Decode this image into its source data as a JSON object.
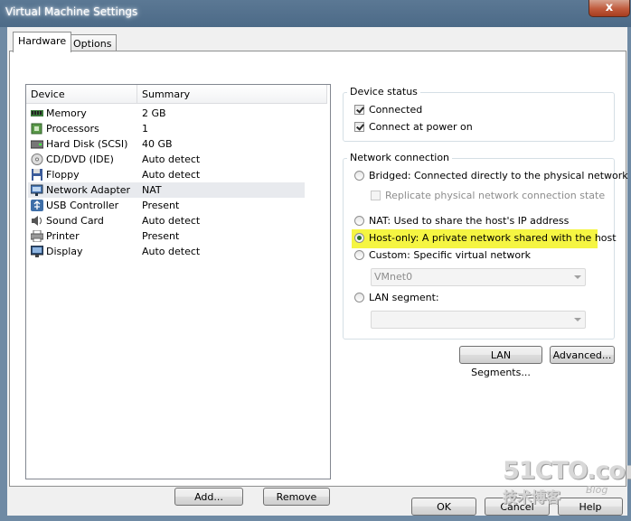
{
  "window": {
    "title": "Virtual Machine Settings",
    "close_glyph": "x"
  },
  "tabs": [
    {
      "label": "Hardware",
      "active": true
    },
    {
      "label": "Options",
      "active": false
    }
  ],
  "device_list": {
    "columns": [
      "Device",
      "Summary"
    ],
    "rows": [
      {
        "icon": "memory-icon",
        "device": "Memory",
        "summary": "2 GB"
      },
      {
        "icon": "processor-icon",
        "device": "Processors",
        "summary": "1"
      },
      {
        "icon": "hard-disk-icon",
        "device": "Hard Disk (SCSI)",
        "summary": "40 GB"
      },
      {
        "icon": "cd-dvd-icon",
        "device": "CD/DVD (IDE)",
        "summary": "Auto detect"
      },
      {
        "icon": "floppy-icon",
        "device": "Floppy",
        "summary": "Auto detect"
      },
      {
        "icon": "network-adapter-icon",
        "device": "Network Adapter",
        "summary": "NAT",
        "selected": true
      },
      {
        "icon": "usb-icon",
        "device": "USB Controller",
        "summary": "Present"
      },
      {
        "icon": "sound-card-icon",
        "device": "Sound Card",
        "summary": "Auto detect"
      },
      {
        "icon": "printer-icon",
        "device": "Printer",
        "summary": "Present"
      },
      {
        "icon": "display-icon",
        "device": "Display",
        "summary": "Auto detect"
      }
    ],
    "add_label": "Add...",
    "remove_label": "Remove"
  },
  "device_status": {
    "legend": "Device status",
    "connected": {
      "label": "Connected",
      "checked": true
    },
    "connect_at_power_on": {
      "label": "Connect at power on",
      "checked": true
    }
  },
  "network_connection": {
    "legend": "Network connection",
    "bridged": {
      "label": "Bridged: Connected directly to the physical network",
      "selected": false
    },
    "replicate": {
      "label": "Replicate physical network connection state",
      "checked": false,
      "enabled": false
    },
    "nat": {
      "label": "NAT: Used to share the host's IP address",
      "selected": false
    },
    "host_only": {
      "label": "Host-only: A private network shared with the host",
      "selected": true
    },
    "custom": {
      "label": "Custom: Specific virtual network",
      "selected": false
    },
    "custom_select_value": "VMnet0",
    "lan_segment": {
      "label": "LAN segment:",
      "selected": false
    },
    "lan_select_value": ""
  },
  "buttons": {
    "lan_segments": "LAN Segments...",
    "advanced": "Advanced...",
    "ok": "OK",
    "cancel": "Cancel",
    "help": "Help"
  },
  "watermark": {
    "main": "51CTO.com",
    "sub": "技术博客",
    "blog": "Blog"
  },
  "colors": {
    "highlight": "#f5f542",
    "title_bar": "#4c6a87",
    "close_button": "#c05a3c"
  }
}
